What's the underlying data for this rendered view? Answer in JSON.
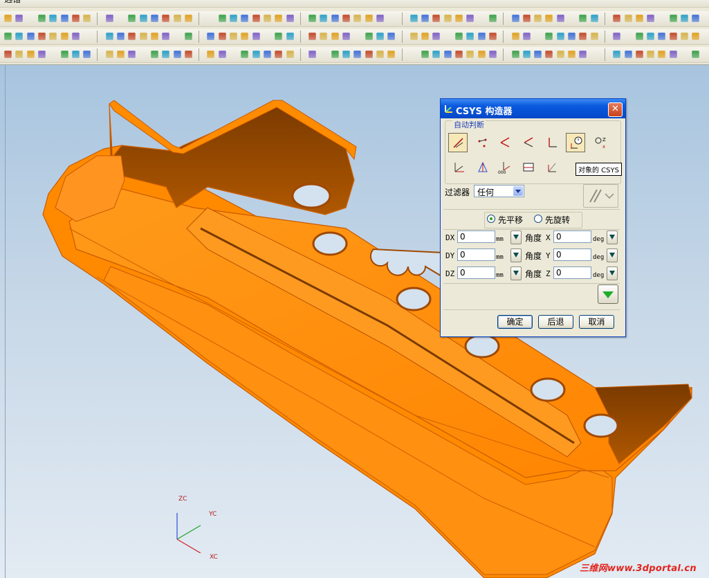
{
  "menu": {
    "selection_label": "选错"
  },
  "dialog": {
    "title": "CSYS 构造器",
    "group_label": "自动判断",
    "tooltip": "对象的 CSYS",
    "filter_label": "过滤器",
    "filter_value": "任何",
    "radio": [
      {
        "label": "先平移",
        "selected": true
      },
      {
        "label": "先旋转",
        "selected": false
      }
    ],
    "translation": [
      {
        "label": "DX",
        "value": "0",
        "unit": "mm"
      },
      {
        "label": "DY",
        "value": "0",
        "unit": "mm"
      },
      {
        "label": "DZ",
        "value": "0",
        "unit": "mm"
      }
    ],
    "rotation": [
      {
        "label": "角度",
        "axis": "X",
        "value": "0",
        "unit": "deg"
      },
      {
        "label": "角度",
        "axis": "Y",
        "value": "0",
        "unit": "deg"
      },
      {
        "label": "角度",
        "axis": "Z",
        "value": "0",
        "unit": "deg"
      }
    ],
    "buttons": {
      "ok": "确定",
      "back": "后退",
      "cancel": "取消"
    }
  },
  "axes": {
    "z": "ZC",
    "y": "YC",
    "x": "XC"
  },
  "watermark": "三维网www.3dportal.cn",
  "colors": {
    "part": "#ff8a00",
    "titlebar": "#0a5ae0",
    "background_top": "#a7c4df"
  }
}
